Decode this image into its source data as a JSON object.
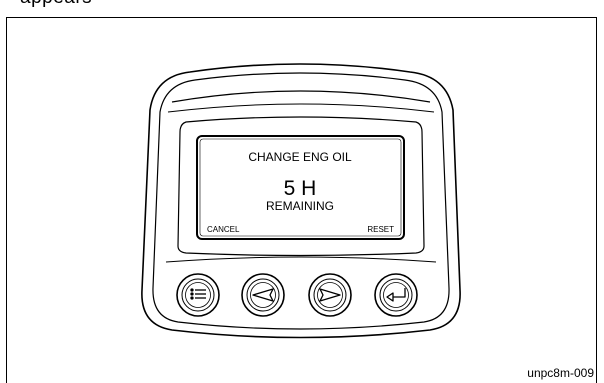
{
  "header": {
    "partial_heading": "appears"
  },
  "display": {
    "line1": "CHANGE ENG OIL",
    "value": "5 H",
    "line3": "REMAINING",
    "softkey_left": "CANCEL",
    "softkey_right": "RESET"
  },
  "buttons": [
    {
      "icon": "menu-list-icon"
    },
    {
      "icon": "arrow-left-icon"
    },
    {
      "icon": "arrow-right-icon"
    },
    {
      "icon": "enter-return-icon"
    }
  ],
  "figure_code": "unpc8m-009"
}
